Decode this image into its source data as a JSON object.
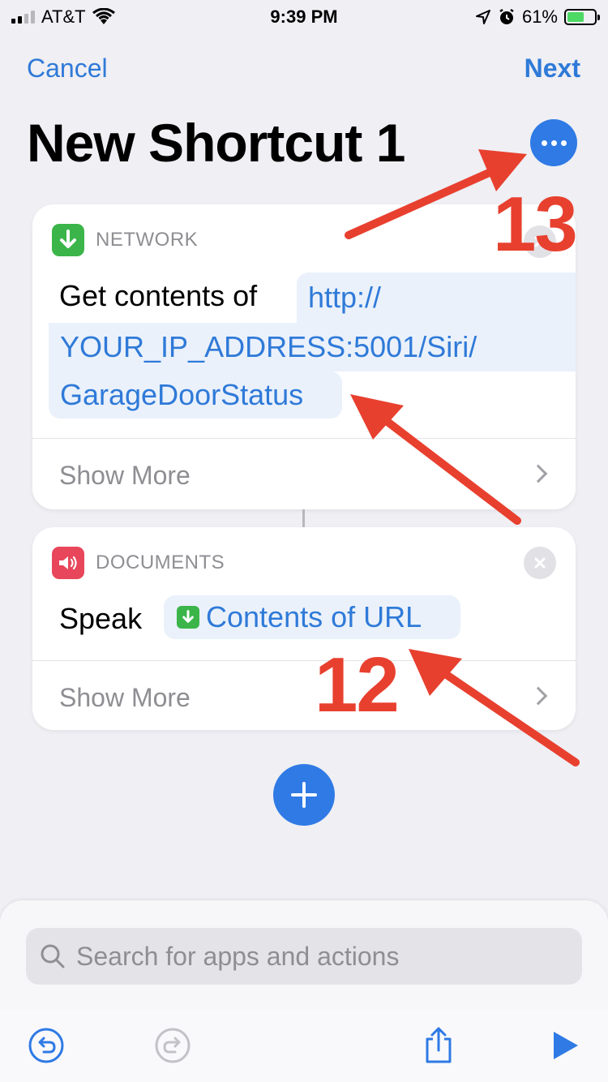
{
  "status_bar": {
    "carrier": "AT&T",
    "time": "9:39 PM",
    "battery": "61%",
    "battery_level": 0.61
  },
  "nav": {
    "cancel_label": "Cancel",
    "next_label": "Next"
  },
  "title": "New Shortcut 1",
  "actions": [
    {
      "category": "NETWORK",
      "action_text": "Get contents of",
      "url_lines": [
        "http://",
        "YOUR_IP_ADDRESS:5001/Siri/",
        "GarageDoorStatus"
      ],
      "show_more": "Show More",
      "icon": "download-arrow-icon",
      "icon_color": "#3bb54a"
    },
    {
      "category": "DOCUMENTS",
      "action_text": "Speak",
      "token": "Contents of URL",
      "show_more": "Show More",
      "icon": "speaker-icon",
      "icon_color": "#e8465a"
    }
  ],
  "search": {
    "placeholder": "Search for apps and actions"
  },
  "annotations": {
    "label_13": "13",
    "label_12": "12",
    "color": "#e8402f"
  },
  "colors": {
    "accent": "#2f7ae5",
    "link": "#2f7ad8",
    "background": "#efeff4"
  }
}
